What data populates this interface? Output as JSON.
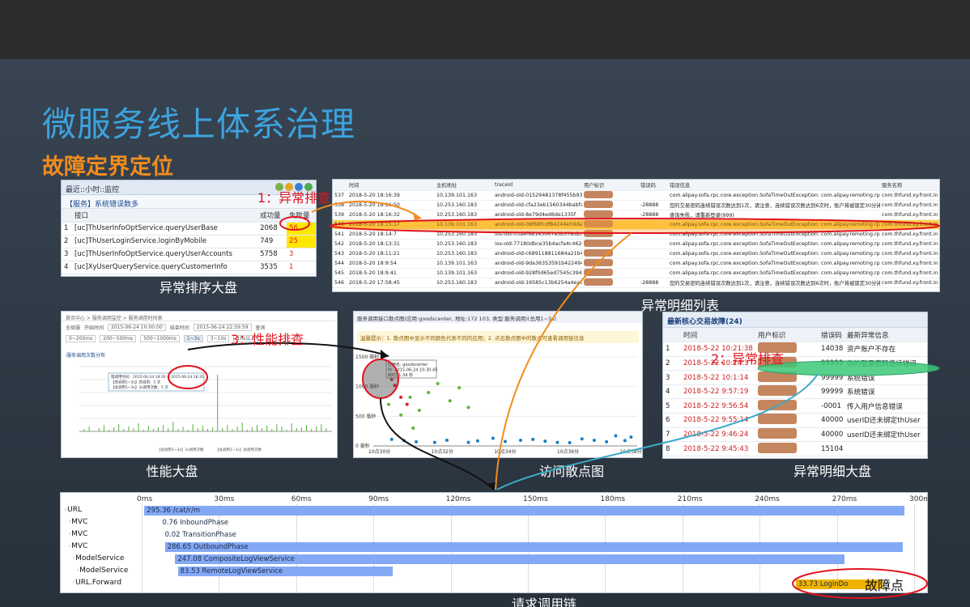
{
  "slide": {
    "title": "微服务线上体系治理",
    "subtitle": "故障定界定位"
  },
  "rank_panel": {
    "header": "最近::小时::监控",
    "subheader": "【服务】系统错误数多",
    "columns": [
      "",
      "接口",
      "成功量",
      "失败量"
    ],
    "rows": [
      {
        "idx": "1",
        "api": "[uc]ThUserInfoOptService.queryUserBase",
        "success": "2068",
        "fail": "56"
      },
      {
        "idx": "2",
        "api": "[uc]ThUserLoginService.loginByMobile",
        "success": "749",
        "fail": "25"
      },
      {
        "idx": "3",
        "api": "[uc]ThUserInfoOptService.queryUserAccounts",
        "success": "5758",
        "fail": "3"
      },
      {
        "idx": "4",
        "api": "[uc]XyUserQueryService.queryCustomerInfo",
        "success": "3535",
        "fail": "1"
      }
    ],
    "caption": "异常排序大盘"
  },
  "detail_panel": {
    "columns": [
      "",
      "时间",
      "主机地址",
      "traceId",
      "用户标识",
      "错误码",
      "错误信息",
      "服务名称"
    ],
    "rows": [
      {
        "idx": "537",
        "time": "2018-5-20 18:16:39",
        "host": "10.139.101.163",
        "trace": "android-old-01529481378f455b93c0",
        "code": "",
        "msg": "com.alipay.sofa.rpc.core.exception.SofaTimeOutException: com.alipay.remoting.rpc.exc",
        "svc": "com.thfund.xy.front.in"
      },
      {
        "idx": "538",
        "time": "2018-5-20 18:16:50",
        "host": "10.253.160.183",
        "trace": "android-old-cfa23eb1560344babfa8",
        "code": "-28888",
        "msg": "您的交易密码连续错误次数达到1次，请注意，连续错误次数达到6次时，账户将被锁定30分钟",
        "svc": "com.thfund.xy.front.in"
      },
      {
        "idx": "539",
        "time": "2018-5-20 18:16:32",
        "host": "10.253.160.183",
        "trace": "android-old-8e79d4ed6de1335f",
        "code": "-28888",
        "msg": "查询失败，请重新登录(999)",
        "svc": "com.thfund.xy.front.in"
      },
      {
        "idx": "540",
        "time": "2018-5-20 18:15:17",
        "host": "10.139.101.163",
        "trace": "android-old-08f68fcdf84244e59da5",
        "code": "",
        "msg": "com.alipay.sofa.rpc.core.exception.SofaTimeOutException: com.alipay.remoting.rpc.exc",
        "svc": "com.thfund.xy.front.in"
      },
      {
        "idx": "541",
        "time": "2018-5-20 18:14:7",
        "host": "10.253.160.183",
        "trace": "ios-old-03a4f68145067a5b578d2d",
        "code": "",
        "msg": "com.alipay.sofa.rpc.core.exception.SofaTimeOutException: com.alipay.remoting.rpc.exc",
        "svc": "com.thfund.xy.front.in"
      },
      {
        "idx": "542",
        "time": "2018-5-20 18:13:31",
        "host": "10.253.160.183",
        "trace": "ios-old-77180dbce35b4acfa4c46208",
        "code": "",
        "msg": "com.alipay.sofa.rpc.core.exception.SofaTimeOutException: com.alipay.remoting.rpc.exc",
        "svc": "com.thfund.xy.front.in"
      },
      {
        "idx": "543",
        "time": "2018-5-20 18:11:21",
        "host": "10.253.160.183",
        "trace": "android-old-c689118811684a21b43",
        "code": "",
        "msg": "com.alipay.sofa.rpc.core.exception.SofaTimeOutException: com.alipay.remoting.rpc.exc",
        "svc": "com.thfund.xy.front.in"
      },
      {
        "idx": "544",
        "time": "2018-5-20 18:9:54",
        "host": "10.139.101.163",
        "trace": "android-old-9da36353591b422494a",
        "code": "",
        "msg": "com.alipay.sofa.rpc.core.exception.SofaTimeOutException: com.alipay.remoting.rpc.exc",
        "svc": "com.thfund.xy.front.in"
      },
      {
        "idx": "545",
        "time": "2018-5-20 18:9:41",
        "host": "10.139.101.163",
        "trace": "android-old-928f0d65ed7545c394ac",
        "code": "",
        "msg": "com.alipay.sofa.rpc.core.exception.SofaTimeOutException: com.alipay.remoting.rpc.exc",
        "svc": "com.thfund.xy.front.in"
      },
      {
        "idx": "546",
        "time": "2018-5-20 17:58:45",
        "host": "10.253.160.183",
        "trace": "android-old-16585c13b6254a4eac7d",
        "code": "-28888",
        "msg": "您的交易密码连续错误次数达到1次，请注意，连续错误次数达到6次时，账户将被锁定30分钟",
        "svc": "com.thfund.xy.front.in"
      }
    ],
    "selected_row": 3,
    "caption": "异常明细列表"
  },
  "perf_panel": {
    "crumb": "首页中心 > 服务调用监控 > 服务调用时间表",
    "filters": [
      "全局服",
      "开始时间",
      "2015-06-24 10:00:00",
      "结束时间",
      "2015-06-24 22:59:59",
      "查询"
    ],
    "ranges": [
      "0~200ms",
      "200~500ms",
      "500~1000ms",
      "1~3s",
      "3~10s",
      "10s以上"
    ],
    "chart_title": "服务调用次数分布",
    "legend": [
      "【总调用1~3s】3s调用次数",
      "【总调用1~3s】总调用次数"
    ],
    "tooltip": [
      "慢调用时间：2015-06-24 18:30 ~ 2015-06-24 18:35",
      "【总调用1~3s】总调用：5 次",
      "【总调用1~3s】3s调用次数：5 次"
    ],
    "caption": "性能大盘"
  },
  "scatter_panel": {
    "title": "服务调用接口散点图(应用:goodscenter, 地址:172",
    "title_tail": "103, 类型:服务调用)(总用1~3s)",
    "note": "温馨提示：1. 散点图中显示不同颜色代表不同的应用；2. 点击散点图中的散点可查看调用链信息",
    "y_ticks": [
      "1500 毫秒",
      "1000 毫秒",
      "500 毫秒",
      "0 毫秒"
    ],
    "x_ticks": [
      "10点30分",
      "10点32分",
      "10点34分",
      "10点36分",
      "10点38分"
    ],
    "tooltip": [
      "应用名: goodscenter",
      "时: 2015-06-24 10:30:45",
      "耗时: 1.34 秒"
    ],
    "caption": "访问散点图"
  },
  "anomaly_panel": {
    "title": "最新核心交易故障(24)",
    "columns": [
      "",
      "时间",
      "用户标识",
      "错误码",
      "最新异常信息"
    ],
    "rows": [
      {
        "idx": "1",
        "time": "2018-5-22 10:21:38",
        "code": "14038",
        "msg": "资产账户不存在"
      },
      {
        "idx": "2",
        "time": "2018-5-22 10:14:3",
        "code": "99999",
        "msg": "你的登录密码连续错误"
      },
      {
        "idx": "3",
        "time": "2018-5-22 10:1:14",
        "code": "99999",
        "msg": "系统错误"
      },
      {
        "idx": "4",
        "time": "2018-5-22 9:57:19",
        "code": "99999",
        "msg": "系统错误"
      },
      {
        "idx": "5",
        "time": "2018-5-22 9:56:54",
        "code": "-0001",
        "msg": "传入用户信息错误"
      },
      {
        "idx": "6",
        "time": "2018-5-22 9:55:14",
        "code": "40000",
        "msg": "userID还未绑定thUser"
      },
      {
        "idx": "7",
        "time": "2018-5-22 9:46:24",
        "code": "40000",
        "msg": "userID还未绑定thUser"
      },
      {
        "idx": "8",
        "time": "2018-5-22 9:45:43",
        "code": "15104",
        "msg": ""
      }
    ],
    "caption": "异常明细大盘"
  },
  "trace_panel": {
    "ticks": [
      "0ms",
      "30ms",
      "60ms",
      "90ms",
      "120ms",
      "150ms",
      "180ms",
      "210ms",
      "240ms",
      "270ms",
      "300ms"
    ],
    "nodes": [
      {
        "label": "URL",
        "depth": 0
      },
      {
        "label": "MVC",
        "depth": 1
      },
      {
        "label": "MVC",
        "depth": 1
      },
      {
        "label": "MVC",
        "depth": 1
      },
      {
        "label": "ModelService",
        "depth": 2
      },
      {
        "label": "ModelService",
        "depth": 3
      },
      {
        "label": "URL.Forward",
        "depth": 2
      }
    ],
    "spans": [
      {
        "text": "295.36 /cat/r/m",
        "start_ms": 1,
        "dur_ms": 295.36,
        "bar": true
      },
      {
        "text": "0.76 InboundPhase",
        "start_ms": 8,
        "dur_ms": 0.76,
        "bar": false
      },
      {
        "text": "0.02 TransitionPhase",
        "start_ms": 9,
        "dur_ms": 0.02,
        "bar": false
      },
      {
        "text": "286.65 OutboundPhase",
        "start_ms": 9,
        "dur_ms": 286.65,
        "bar": true
      },
      {
        "text": "247.08 CompositeLogViewService",
        "start_ms": 13,
        "dur_ms": 260.08,
        "bar": true
      },
      {
        "text": "83.53 RemoteLogViewService",
        "start_ms": 14,
        "dur_ms": 83.53,
        "bar": true
      },
      {
        "text": "33.73 LoginDo",
        "start_ms": 254,
        "dur_ms": 33.73,
        "bar": true
      }
    ],
    "max_ms": 300,
    "caption": "请求调用链"
  },
  "annotations": {
    "a1": "1：异常排查",
    "a2": "2：异常排查",
    "a3": "3：性能排查",
    "fault": "故障点"
  },
  "chart_data": {
    "type": "scatter",
    "title": "服务调用接口散点图",
    "ylim": [
      0,
      1500
    ],
    "ylabel": "毫秒",
    "x_ticks": [
      "10点30分",
      "10点32分",
      "10点34分",
      "10点36分",
      "10点38分"
    ],
    "series": [
      {
        "color": "#1a7fc4",
        "points": [
          [
            0.6,
            110
          ],
          [
            1.0,
            90
          ],
          [
            1.4,
            70
          ],
          [
            2.0,
            60
          ],
          [
            2.4,
            95
          ],
          [
            3.1,
            60
          ],
          [
            3.4,
            85
          ],
          [
            3.9,
            130
          ],
          [
            4.3,
            75
          ],
          [
            4.8,
            95
          ],
          [
            5.2,
            110
          ],
          [
            5.6,
            80
          ],
          [
            6.0,
            60
          ],
          [
            6.4,
            55
          ],
          [
            6.8,
            120
          ],
          [
            7.2,
            95
          ],
          [
            7.6,
            70
          ],
          [
            7.9,
            170
          ],
          [
            8.2,
            90
          ],
          [
            8.4,
            150
          ]
        ]
      },
      {
        "color": "#5cb531",
        "points": [
          [
            0.8,
            1250
          ],
          [
            1.2,
            820
          ],
          [
            1.5,
            600
          ],
          [
            1.8,
            900
          ],
          [
            2.1,
            1050
          ],
          [
            2.5,
            760
          ],
          [
            2.8,
            980
          ],
          [
            3.1,
            650
          ],
          [
            0.9,
            520
          ],
          [
            1.3,
            300
          ],
          [
            0.5,
            700
          ]
        ]
      },
      {
        "color": "#d8262a",
        "points": [
          [
            0.6,
            1120
          ],
          [
            0.7,
            1020
          ],
          [
            0.9,
            820
          ],
          [
            1.1,
            700
          ]
        ]
      }
    ]
  }
}
